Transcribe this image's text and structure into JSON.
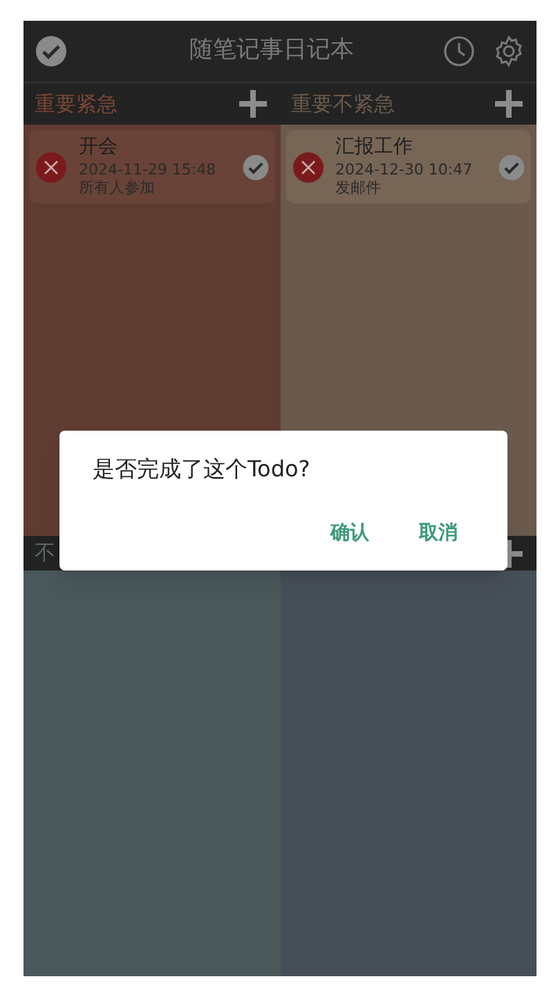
{
  "app_bar": {
    "title": "随笔记事日记本"
  },
  "quadrants": [
    {
      "title": "重要紧急",
      "items": [
        {
          "title": "开会",
          "time": "2024-11-29 15:48",
          "note": "所有人参加"
        }
      ]
    },
    {
      "title": "重要不紧急",
      "items": [
        {
          "title": "汇报工作",
          "time": "2024-12-30 10:47",
          "note": "发邮件"
        }
      ]
    },
    {
      "title": "不"
    }
  ],
  "dialog": {
    "message": "是否完成了这个Todo?",
    "buttons": [
      "确认",
      "取消"
    ]
  }
}
